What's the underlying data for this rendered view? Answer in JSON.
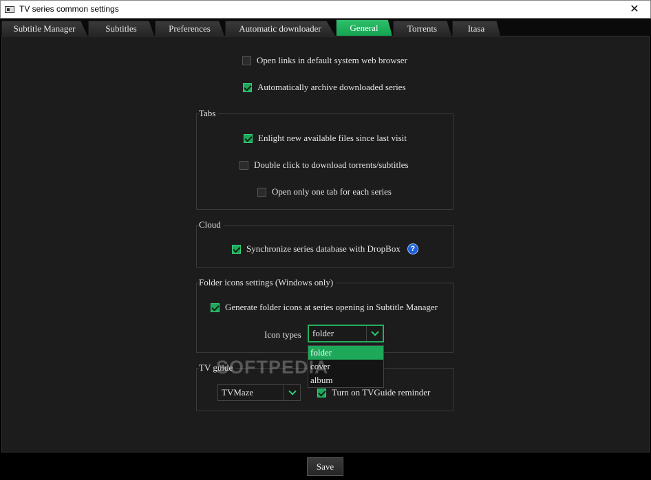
{
  "window": {
    "title": "TV series common settings",
    "close_glyph": "✕"
  },
  "tabs": [
    {
      "label": "Subtitle Manager"
    },
    {
      "label": "Subtitles"
    },
    {
      "label": "Preferences"
    },
    {
      "label": "Automatic downloader"
    },
    {
      "label": "General",
      "active": true
    },
    {
      "label": "Torrents"
    },
    {
      "label": "Itasa"
    }
  ],
  "general": {
    "open_links": {
      "label": "Open links in default system web browser",
      "checked": false
    },
    "auto_archive": {
      "label": "Automatically archive downloaded series",
      "checked": true
    }
  },
  "tabs_group": {
    "title": "Tabs",
    "enlight": {
      "label": "Enlight new available files since last visit",
      "checked": true
    },
    "double_click": {
      "label": "Double click to download torrents/subtitles",
      "checked": false
    },
    "one_tab": {
      "label": "Open only one tab for each series",
      "checked": false
    }
  },
  "cloud_group": {
    "title": "Cloud",
    "sync": {
      "label": "Synchronize series database with DropBox",
      "checked": true
    },
    "help_glyph": "?"
  },
  "folder_group": {
    "title": "Folder icons settings (Windows only)",
    "generate": {
      "label": "Generate folder icons at series opening in Subtitle Manager",
      "checked": true
    },
    "icon_types_label": "Icon types",
    "icon_types_value": "folder",
    "icon_types_options": [
      "folder",
      "cover",
      "album"
    ]
  },
  "tvguide_group": {
    "title": "TV guide",
    "source_value": "TVMaze",
    "reminder": {
      "label": "Turn on TVGuide reminder",
      "checked": true
    }
  },
  "footer": {
    "save_label": "Save"
  },
  "watermark": "SOFTPEDIA",
  "colors": {
    "accent": "#1ea85a",
    "background": "#1c1c1c"
  }
}
